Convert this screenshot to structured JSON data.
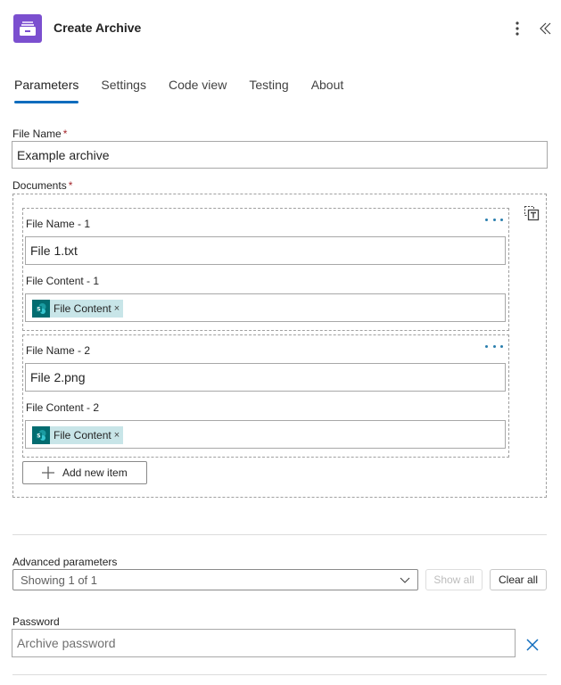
{
  "header": {
    "title": "Create Archive",
    "icon": "archive-drawer-icon",
    "accent_color": "#7b4fcf",
    "actions": [
      "more-vertical-icon",
      "collapse-double-chevron-icon"
    ]
  },
  "tabs": [
    {
      "label": "Parameters",
      "active": true
    },
    {
      "label": "Settings",
      "active": false
    },
    {
      "label": "Code view",
      "active": false
    },
    {
      "label": "Testing",
      "active": false
    },
    {
      "label": "About",
      "active": false
    }
  ],
  "parameters": {
    "file_name": {
      "label": "File Name",
      "required_mark": "*",
      "value": "Example archive"
    },
    "documents": {
      "label": "Documents",
      "required_mark": "*",
      "items": [
        {
          "name_label": "File Name - 1",
          "name_value": "File 1.txt",
          "content_label": "File Content - 1",
          "content_token": {
            "label": "File Content",
            "remove": "×",
            "icon": "sharepoint-icon"
          }
        },
        {
          "name_label": "File Name - 2",
          "name_value": "File 2.png",
          "content_label": "File Content - 2",
          "content_token": {
            "label": "File Content",
            "remove": "×",
            "icon": "sharepoint-icon"
          }
        }
      ],
      "add_item_label": "Add new item"
    },
    "advanced": {
      "label": "Advanced parameters",
      "select_value": "Showing 1 of 1",
      "show_all_label": "Show all",
      "show_all_disabled": true,
      "clear_all_label": "Clear all"
    },
    "password": {
      "label": "Password",
      "value": "",
      "placeholder": "Archive password"
    }
  },
  "colors": {
    "tab_indicator": "#0f6cbd",
    "required": "#a4262c",
    "token_bg": "#c8e5e8",
    "token_icon_bg": "#036c70",
    "clear_x": "#0f6cbd"
  }
}
